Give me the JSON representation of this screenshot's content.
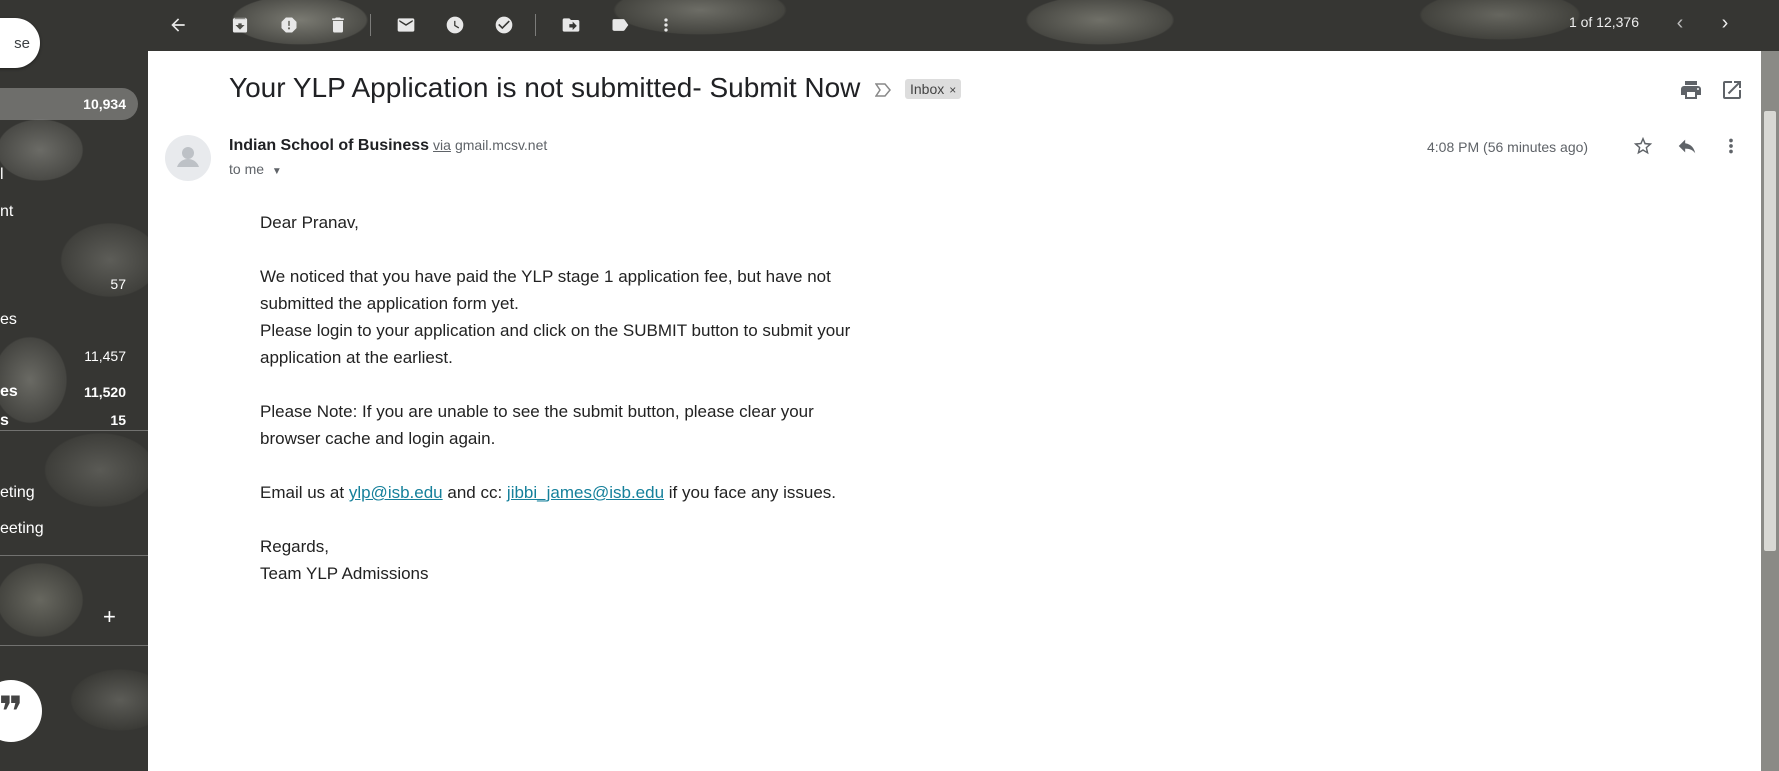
{
  "sidebar": {
    "compose_label": "se",
    "items": [
      {
        "label": "",
        "count": "10,934"
      },
      {
        "label": "l",
        "count": ""
      },
      {
        "label": "nt",
        "count": ""
      },
      {
        "label": "",
        "count": "57"
      },
      {
        "label": "es",
        "count": ""
      },
      {
        "label": "",
        "count": "11,457"
      },
      {
        "label": "es",
        "count": "11,520"
      },
      {
        "label": "s",
        "count": "15"
      },
      {
        "label": "eting",
        "count": ""
      },
      {
        "label": "eeting",
        "count": ""
      }
    ],
    "plus_label": "+",
    "hangouts_glyph": "❞"
  },
  "toolbar": {
    "icons": [
      "back-icon",
      "archive-icon",
      "report-spam-icon",
      "delete-icon",
      "mark-unread-icon",
      "snooze-icon",
      "add-task-icon",
      "move-to-icon",
      "label-icon",
      "more-icon"
    ],
    "pager": "1 of 12,376"
  },
  "email": {
    "subject": "Your YLP Application is not submitted- Submit Now",
    "label_chip": "Inbox",
    "label_chip_close": "×",
    "sender_name": "Indian School of Business",
    "via": "via",
    "sender_domain": "gmail.mcsv.net",
    "to": "to me",
    "time": "4:08 PM (56 minutes ago)",
    "greeting": "Dear Pranav,",
    "para1": "We noticed that you have paid the YLP stage 1 application fee, but have not submitted the application form yet.",
    "para2": "Please login to your application and click on the SUBMIT button to submit your application at the earliest.",
    "para3": "Please Note: If you are unable to see the submit button, please clear your browser cache and login again.",
    "contact_prefix": "Email us at",
    "contact_email1": "ylp@isb.edu",
    "contact_mid": "and cc:",
    "contact_email2": "jibbi_james@isb.edu",
    "contact_suffix": "if you face any issues.",
    "signoff": "Regards,",
    "signature": "Team YLP Admissions"
  },
  "colors": {
    "link": "#15809b",
    "panel": "#ffffff",
    "text": "#202124",
    "meta": "#5f6368"
  }
}
